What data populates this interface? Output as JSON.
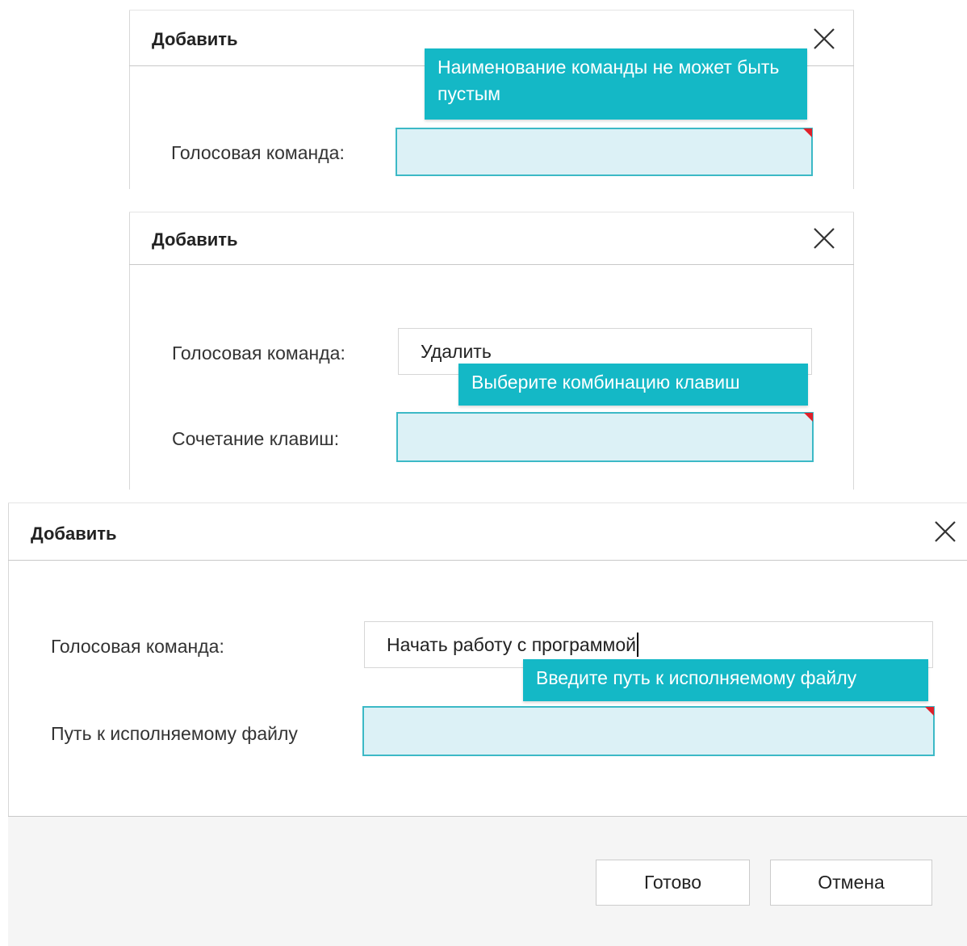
{
  "dialogs": [
    {
      "title": "Добавить",
      "fields": [
        {
          "label": "Голосовая команда:",
          "value": ""
        }
      ],
      "tooltip": "Наименование команды не может быть пустым"
    },
    {
      "title": "Добавить",
      "fields": [
        {
          "label": "Голосовая команда:",
          "value": "Удалить"
        },
        {
          "label": "Сочетание клавиш:",
          "value": ""
        }
      ],
      "tooltip": "Выберите комбинацию клавиш"
    },
    {
      "title": "Добавить",
      "fields": [
        {
          "label": "Голосовая команда:",
          "value": "Начать работу с программой"
        },
        {
          "label": "Путь к исполняемому файлу",
          "value": ""
        }
      ],
      "tooltip": "Введите путь к исполняемому файлу",
      "buttons": {
        "ok": "Готово",
        "cancel": "Отмена"
      }
    }
  ],
  "icons": {
    "close": "close-icon"
  },
  "colors": {
    "tooltip_bg": "#14b8c6",
    "invalid_bg": "#dcf1f6",
    "invalid_border": "#3cb9c6",
    "invalid_marker": "#e0202a"
  }
}
